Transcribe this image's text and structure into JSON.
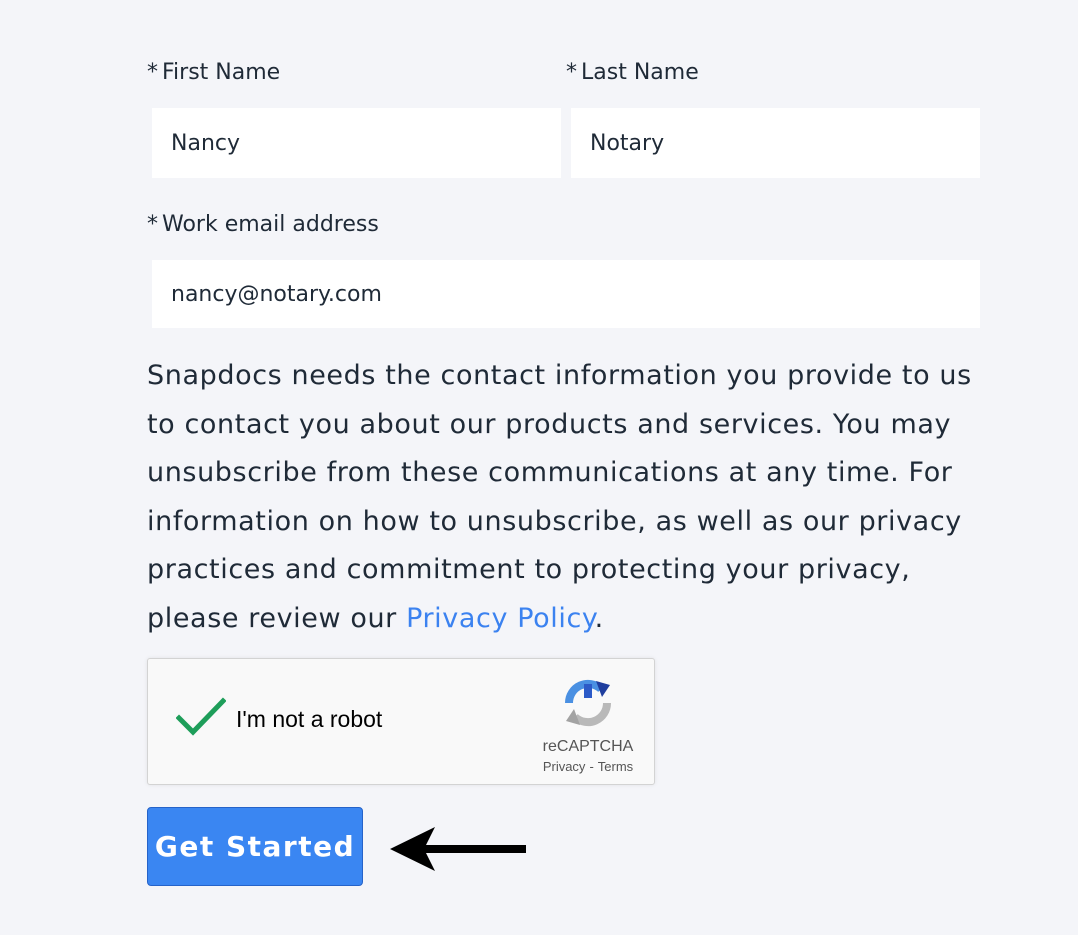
{
  "form": {
    "required_marker": "*",
    "first_name": {
      "label": "First Name",
      "value": "Nancy"
    },
    "last_name": {
      "label": "Last Name",
      "value": "Notary"
    },
    "email": {
      "label": "Work email address",
      "value": "nancy@notary.com"
    }
  },
  "notice": {
    "text": "Snapdocs needs the contact information you provide to us to contact you about our products and services. You may unsubscribe from these communications at any time. For information on how to unsubscribe, as well as our privacy practices and commitment to protecting your privacy, please review our ",
    "link_text": "Privacy Policy",
    "suffix": "."
  },
  "captcha": {
    "label": "I'm not a robot",
    "brand": "reCAPTCHA",
    "privacy_link": "Privacy",
    "separator": "-",
    "terms_link": "Terms",
    "checked": true,
    "check_color": "#1e9e5a"
  },
  "cta": {
    "label": "Get Started",
    "color": "#3a86f2"
  },
  "annotation": {
    "icon": "left-arrow-icon"
  }
}
